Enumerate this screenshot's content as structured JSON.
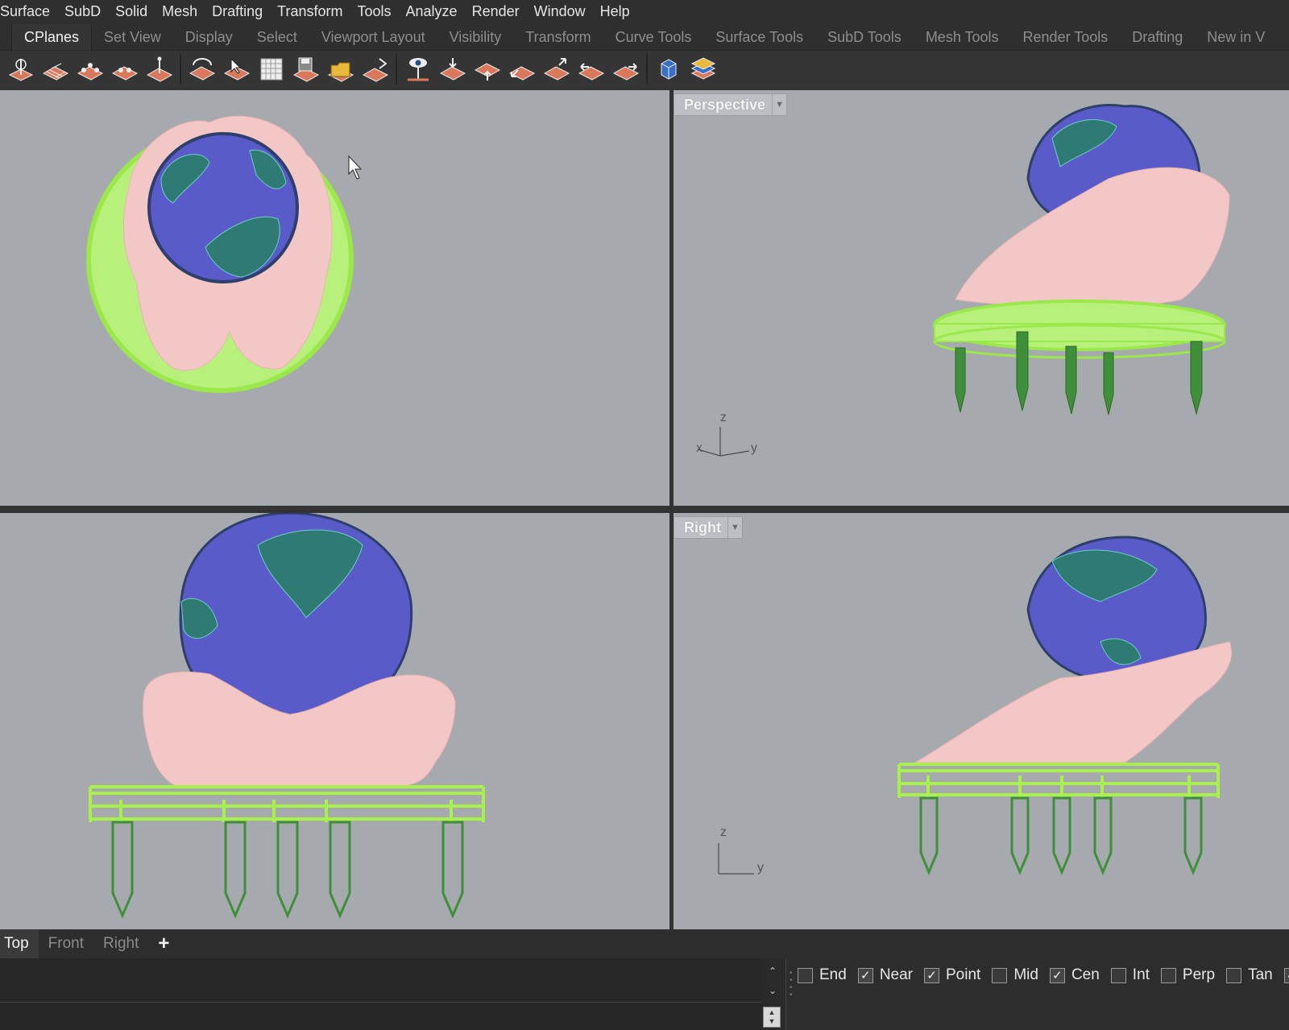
{
  "menubar": {
    "items": [
      "Surface",
      "SubD",
      "Solid",
      "Mesh",
      "Drafting",
      "Transform",
      "Tools",
      "Analyze",
      "Render",
      "Window",
      "Help"
    ]
  },
  "toolbar_tabs": {
    "items": [
      "CPlanes",
      "Set View",
      "Display",
      "Select",
      "Viewport Layout",
      "Visibility",
      "Transform",
      "Curve Tools",
      "Surface Tools",
      "SubD Tools",
      "Mesh Tools",
      "Render Tools",
      "Drafting",
      "New in V"
    ],
    "active": "CPlanes"
  },
  "viewports": {
    "perspective": {
      "label": "Perspective",
      "axes": {
        "z": "z",
        "x": "x",
        "y": "y"
      }
    },
    "right": {
      "label": "Right",
      "axes": {
        "z": "z",
        "y": "y"
      }
    }
  },
  "viewport_tabs": {
    "items": [
      "Top",
      "Front",
      "Right"
    ],
    "active": "Top",
    "add": "+"
  },
  "command": {
    "input_value": ""
  },
  "osnap": {
    "items": [
      {
        "label": "End",
        "checked": false
      },
      {
        "label": "Near",
        "checked": true
      },
      {
        "label": "Point",
        "checked": true
      },
      {
        "label": "Mid",
        "checked": false
      },
      {
        "label": "Cen",
        "checked": true
      },
      {
        "label": "Int",
        "checked": false
      },
      {
        "label": "Perp",
        "checked": false
      },
      {
        "label": "Tan",
        "checked": false
      },
      {
        "label": "",
        "checked": true
      }
    ]
  },
  "colors": {
    "globe_ocean": "#5b5bc8",
    "globe_land": "#2f7a72",
    "hands": "#f4c6c4",
    "base_lime": "#a8f04a",
    "legs": "#3f8f3a",
    "viewport_bg": "#a6aaae"
  }
}
